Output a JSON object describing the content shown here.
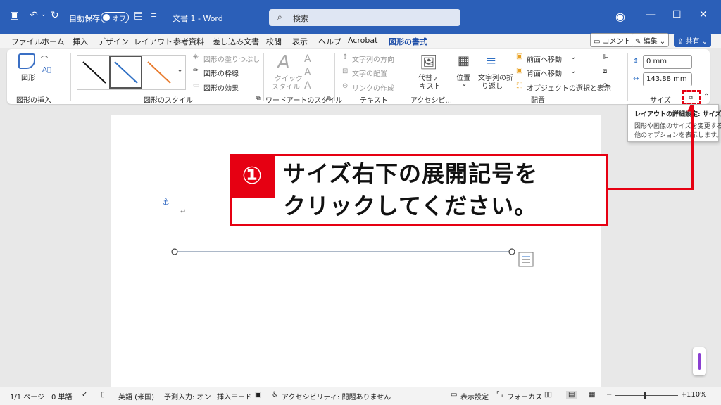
{
  "titlebar": {
    "autosave_label": "自動保存",
    "autosave_state": "オフ",
    "doc_title": "文書 1 - Word",
    "search_placeholder": "検索"
  },
  "menu": {
    "tabs": [
      "ファイル",
      "ホーム",
      "挿入",
      "デザイン",
      "レイアウト",
      "参考資料",
      "差し込み文書",
      "校閲",
      "表示",
      "ヘルプ",
      "Acrobat",
      "図形の書式"
    ],
    "active_tab": "図形の書式",
    "comment_btn": "コメント",
    "edit_btn": "編集",
    "share_btn": "共有"
  },
  "ribbon": {
    "insert_shape": {
      "label": "図形の挿入",
      "shape_btn": "図形"
    },
    "shape_styles": {
      "label": "図形のスタイル",
      "fill": "図形の塗りつぶし",
      "outline": "図形の枠線",
      "effect": "図形の効果"
    },
    "wordart": {
      "label": "ワードアートのスタイル",
      "quick": "クイック",
      "style": "スタイル"
    },
    "text": {
      "label": "テキスト",
      "direction": "文字列の方向",
      "align": "文字の配置",
      "link": "リンクの作成"
    },
    "accessibility": {
      "label": "アクセシビ...",
      "alt1": "代替テ",
      "alt2": "キスト"
    },
    "arrange": {
      "label": "配置",
      "position": "位置",
      "wrap1": "文字列の折",
      "wrap2": "り返し",
      "forward": "前面へ移動",
      "backward": "背面へ移動",
      "select": "オブジェクトの選択と表示"
    },
    "size": {
      "label": "サイズ",
      "height": "0 mm",
      "width": "143.88 mm"
    }
  },
  "tooltip": {
    "title": "レイアウトの詳細設定: サイズ",
    "line1": "図形や画像のサイズを変更する",
    "line2": "他のオプションを表示します。"
  },
  "callout": {
    "number": "①",
    "line1": "サイズ右下の展開記号を",
    "line2": "クリックしてください。"
  },
  "status": {
    "page": "1/1 ページ",
    "words": "0 単語",
    "lang": "英語 (米国)",
    "predict": "予測入力: オン",
    "insert_mode": "挿入モード",
    "accessibility": "アクセシビリティ: 問題ありません",
    "display": "表示設定",
    "focus": "フォーカス",
    "zoom": "110%"
  },
  "colors": {
    "titlebar": "#2b5fb8",
    "accent_red": "#e60012",
    "active_tab": "#1e4ea8"
  }
}
